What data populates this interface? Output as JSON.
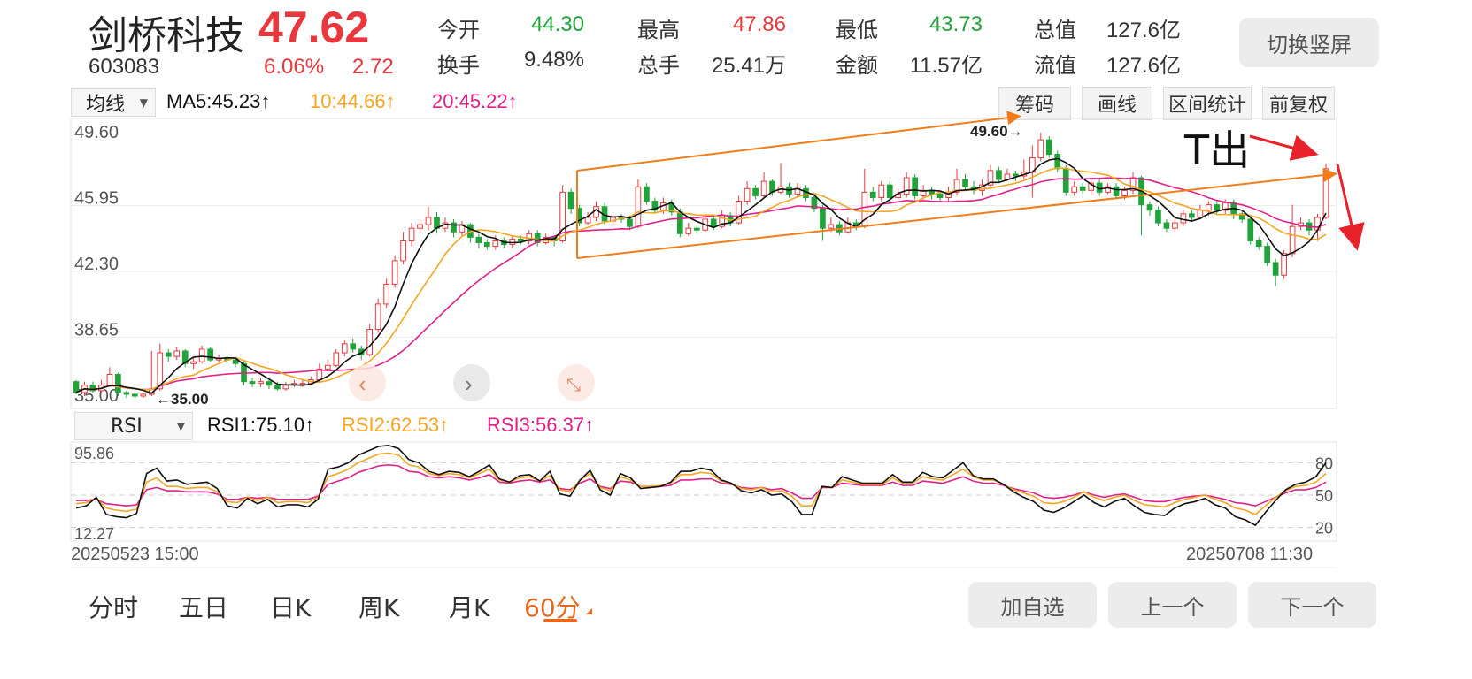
{
  "stock": {
    "name": "剑桥科技",
    "price": "47.62",
    "code": "603083",
    "pct": "6.06%",
    "change": "2.72"
  },
  "stats": [
    {
      "label": "今开",
      "value": "44.30",
      "color": "#21a33a"
    },
    {
      "label": "最高",
      "value": "47.86",
      "color": "#e8383d"
    },
    {
      "label": "最低",
      "value": "43.73",
      "color": "#21a33a"
    },
    {
      "label": "总值",
      "value": "127.6亿",
      "color": "#333333"
    },
    {
      "label": "换手",
      "value": "9.48%",
      "color": "#333333"
    },
    {
      "label": "总手",
      "value": "25.41万",
      "color": "#333333"
    },
    {
      "label": "金额",
      "value": "11.57亿",
      "color": "#333333"
    },
    {
      "label": "流值",
      "value": "127.6亿",
      "color": "#333333"
    }
  ],
  "switch_label": "切换竖屏",
  "ma": {
    "selector": "均线",
    "ma5": "MA5:45.23↑",
    "ma10": "10:44.66↑",
    "ma20": "20:45.22↑"
  },
  "tools": [
    "筹码",
    "画线",
    "区间统计",
    "前复权"
  ],
  "rsi": {
    "selector": "RSI",
    "rsi1": "RSI1:75.10↑",
    "rsi2": "RSI2:62.53↑",
    "rsi3": "RSI3:56.37↑"
  },
  "colors": {
    "up": "#e8383d",
    "down": "#21a33a",
    "ma5": "#111111",
    "ma10": "#f5a623",
    "ma20": "#e0218a",
    "channel": "#f07d1a",
    "accent": "#e8661e"
  },
  "chart_data": {
    "type": "candlestick",
    "price_axis_labels": [
      "49.60",
      "45.95",
      "42.30",
      "38.65",
      "35.00"
    ],
    "ylim": [
      35.0,
      49.6
    ],
    "annotations": {
      "high": "49.60→",
      "low": "←35.00",
      "handwritten": "T出"
    },
    "start_time": "20250523 15:00",
    "end_time": "20250708 11:30",
    "candles": [
      [
        35.8,
        35.2,
        35.9,
        35.1
      ],
      [
        35.2,
        35.6,
        35.8,
        35.0
      ],
      [
        35.6,
        35.3,
        35.8,
        35.2
      ],
      [
        35.3,
        35.6,
        35.9,
        35.2
      ],
      [
        35.6,
        36.2,
        36.6,
        35.5
      ],
      [
        36.2,
        35.2,
        36.3,
        35.0
      ],
      [
        35.2,
        35.1,
        35.3,
        34.9
      ],
      [
        35.1,
        35.0,
        35.2,
        34.9
      ],
      [
        35.0,
        35.1,
        35.2,
        34.9
      ],
      [
        35.1,
        35.4,
        37.5,
        35.0
      ],
      [
        35.4,
        37.4,
        37.9,
        35.3
      ],
      [
        37.4,
        37.2,
        37.6,
        36.9
      ],
      [
        37.2,
        37.5,
        37.7,
        37.0
      ],
      [
        37.5,
        36.8,
        37.6,
        36.6
      ],
      [
        36.8,
        36.9,
        37.1,
        36.5
      ],
      [
        36.9,
        37.6,
        37.8,
        36.8
      ],
      [
        37.6,
        37.0,
        37.7,
        36.9
      ],
      [
        37.0,
        37.1,
        37.3,
        36.9
      ],
      [
        37.1,
        37.0,
        37.3,
        36.8
      ],
      [
        37.0,
        36.8,
        37.1,
        36.6
      ],
      [
        36.8,
        35.8,
        37.0,
        35.6
      ],
      [
        35.8,
        35.7,
        36.0,
        35.5
      ],
      [
        35.7,
        35.8,
        36.0,
        35.5
      ],
      [
        35.8,
        35.6,
        36.0,
        35.4
      ],
      [
        35.6,
        35.4,
        35.8,
        35.3
      ],
      [
        35.4,
        35.6,
        35.8,
        35.3
      ],
      [
        35.6,
        35.7,
        35.9,
        35.5
      ],
      [
        35.7,
        35.7,
        35.9,
        35.5
      ],
      [
        35.7,
        35.9,
        36.1,
        35.6
      ],
      [
        35.9,
        36.5,
        36.8,
        35.8
      ],
      [
        36.5,
        36.7,
        37.0,
        36.4
      ],
      [
        36.7,
        37.4,
        37.6,
        36.6
      ],
      [
        37.4,
        37.9,
        38.1,
        37.2
      ],
      [
        37.9,
        37.6,
        38.2,
        37.4
      ],
      [
        37.6,
        37.3,
        37.8,
        37.0
      ],
      [
        37.3,
        38.7,
        39.0,
        37.2
      ],
      [
        38.7,
        40.1,
        40.4,
        38.5
      ],
      [
        40.1,
        41.2,
        41.5,
        39.9
      ],
      [
        41.2,
        42.5,
        42.8,
        41.0
      ],
      [
        42.5,
        43.6,
        44.1,
        42.3
      ],
      [
        43.6,
        44.3,
        44.6,
        43.3
      ],
      [
        44.3,
        44.5,
        44.8,
        44.0
      ],
      [
        44.5,
        44.9,
        45.5,
        44.2
      ],
      [
        44.9,
        44.3,
        45.2,
        44.0
      ],
      [
        44.3,
        44.6,
        44.9,
        44.1
      ],
      [
        44.6,
        44.1,
        44.8,
        43.8
      ],
      [
        44.1,
        44.5,
        44.7,
        43.9
      ],
      [
        44.5,
        43.8,
        44.6,
        43.5
      ],
      [
        43.8,
        43.5,
        44.0,
        43.2
      ],
      [
        43.5,
        43.3,
        43.7,
        43.1
      ],
      [
        43.3,
        43.6,
        43.9,
        43.1
      ],
      [
        43.6,
        43.4,
        43.8,
        43.2
      ],
      [
        43.4,
        43.7,
        43.9,
        43.2
      ],
      [
        43.7,
        43.6,
        43.9,
        43.4
      ],
      [
        43.6,
        44.0,
        44.2,
        43.4
      ],
      [
        44.0,
        43.5,
        44.2,
        43.3
      ],
      [
        43.5,
        43.8,
        44.0,
        43.4
      ],
      [
        43.8,
        43.6,
        43.9,
        43.3
      ],
      [
        43.6,
        46.3,
        46.7,
        43.5
      ],
      [
        46.3,
        45.4,
        46.5,
        45.1
      ],
      [
        45.4,
        44.6,
        45.6,
        44.4
      ],
      [
        44.6,
        44.9,
        45.2,
        44.5
      ],
      [
        44.9,
        45.5,
        45.8,
        44.7
      ],
      [
        45.5,
        44.7,
        45.7,
        44.5
      ],
      [
        44.7,
        44.9,
        45.1,
        44.5
      ],
      [
        44.9,
        44.8,
        45.1,
        44.6
      ],
      [
        44.8,
        44.4,
        45.0,
        44.2
      ],
      [
        44.4,
        46.6,
        47.0,
        44.3
      ],
      [
        46.6,
        45.8,
        46.8,
        45.6
      ],
      [
        45.8,
        45.3,
        46.0,
        45.1
      ],
      [
        45.3,
        45.7,
        46.0,
        45.1
      ],
      [
        45.7,
        45.2,
        45.9,
        45.0
      ],
      [
        45.2,
        44.0,
        45.4,
        43.8
      ],
      [
        44.0,
        44.3,
        44.6,
        43.9
      ],
      [
        44.3,
        44.2,
        44.5,
        44.0
      ],
      [
        44.2,
        44.8,
        45.0,
        44.1
      ],
      [
        44.8,
        44.4,
        45.0,
        44.2
      ],
      [
        44.4,
        45.0,
        45.3,
        44.3
      ],
      [
        45.0,
        44.6,
        45.2,
        44.4
      ],
      [
        44.6,
        45.8,
        46.1,
        44.5
      ],
      [
        45.8,
        46.5,
        46.9,
        45.6
      ],
      [
        46.5,
        46.1,
        46.7,
        45.9
      ],
      [
        46.1,
        46.9,
        47.4,
        46.0
      ],
      [
        46.9,
        46.3,
        47.0,
        46.1
      ],
      [
        46.3,
        46.6,
        47.9,
        46.2
      ],
      [
        46.6,
        46.2,
        46.8,
        46.0
      ],
      [
        46.2,
        46.5,
        46.8,
        46.0
      ],
      [
        46.5,
        46.0,
        46.7,
        45.8
      ],
      [
        46.0,
        45.4,
        46.2,
        45.2
      ],
      [
        45.4,
        44.3,
        45.6,
        43.6
      ],
      [
        44.3,
        44.5,
        44.9,
        44.1
      ],
      [
        44.5,
        44.1,
        44.7,
        43.9
      ],
      [
        44.1,
        44.6,
        44.9,
        44.0
      ],
      [
        44.6,
        44.4,
        44.8,
        44.2
      ],
      [
        44.4,
        46.3,
        47.6,
        44.3
      ],
      [
        46.3,
        46.0,
        46.6,
        45.8
      ],
      [
        46.0,
        46.7,
        46.9,
        45.8
      ],
      [
        46.7,
        46.0,
        46.9,
        45.8
      ],
      [
        46.0,
        46.2,
        46.5,
        45.9
      ],
      [
        46.2,
        47.1,
        47.4,
        46.0
      ],
      [
        47.1,
        46.1,
        47.3,
        45.9
      ],
      [
        46.1,
        46.4,
        46.7,
        45.9
      ],
      [
        46.4,
        46.2,
        46.6,
        45.9
      ],
      [
        46.2,
        46.0,
        46.4,
        45.8
      ],
      [
        46.0,
        46.3,
        46.6,
        45.8
      ],
      [
        46.3,
        47.0,
        47.6,
        46.1
      ],
      [
        47.0,
        46.6,
        47.3,
        46.4
      ],
      [
        46.6,
        46.4,
        46.9,
        46.2
      ],
      [
        46.4,
        46.7,
        47.0,
        46.1
      ],
      [
        46.7,
        47.5,
        47.8,
        46.5
      ],
      [
        47.5,
        47.0,
        47.7,
        46.8
      ],
      [
        47.0,
        47.3,
        47.6,
        46.9
      ],
      [
        47.3,
        47.2,
        47.5,
        46.9
      ],
      [
        47.2,
        47.4,
        48.1,
        47.0
      ],
      [
        47.4,
        48.2,
        48.9,
        46.0
      ],
      [
        48.2,
        49.2,
        49.6,
        48.0
      ],
      [
        49.2,
        48.4,
        49.4,
        48.2
      ],
      [
        48.4,
        47.6,
        48.6,
        47.4
      ],
      [
        47.6,
        46.3,
        47.8,
        46.1
      ],
      [
        46.3,
        46.6,
        46.9,
        46.1
      ],
      [
        46.6,
        46.4,
        46.8,
        46.2
      ],
      [
        46.4,
        46.8,
        47.0,
        46.1
      ],
      [
        46.8,
        46.3,
        47.0,
        46.1
      ],
      [
        46.3,
        46.6,
        46.8,
        46.2
      ],
      [
        46.6,
        46.1,
        46.8,
        45.9
      ],
      [
        46.1,
        46.4,
        46.6,
        45.9
      ],
      [
        46.4,
        47.1,
        47.4,
        46.2
      ],
      [
        47.1,
        45.6,
        47.2,
        43.9
      ],
      [
        45.6,
        45.3,
        45.8,
        45.0
      ],
      [
        45.3,
        44.6,
        45.5,
        44.4
      ],
      [
        44.6,
        44.3,
        44.8,
        44.1
      ],
      [
        44.3,
        44.6,
        44.8,
        44.1
      ],
      [
        44.6,
        45.1,
        45.3,
        44.4
      ],
      [
        45.1,
        44.9,
        45.3,
        44.7
      ],
      [
        44.9,
        45.3,
        45.6,
        44.8
      ],
      [
        45.3,
        45.6,
        45.8,
        45.0
      ],
      [
        45.6,
        45.3,
        45.8,
        45.1
      ],
      [
        45.3,
        45.7,
        45.9,
        45.1
      ],
      [
        45.7,
        45.1,
        45.9,
        44.8
      ],
      [
        45.1,
        44.8,
        45.3,
        44.6
      ],
      [
        44.8,
        43.6,
        45.0,
        43.4
      ],
      [
        43.6,
        43.3,
        43.8,
        43.1
      ],
      [
        43.3,
        42.4,
        43.5,
        42.2
      ],
      [
        42.4,
        41.7,
        42.6,
        41.1
      ],
      [
        41.7,
        42.9,
        43.1,
        41.5
      ],
      [
        42.9,
        44.4,
        45.6,
        42.7
      ],
      [
        44.4,
        44.6,
        44.9,
        44.2
      ],
      [
        44.6,
        44.2,
        44.8,
        43.9
      ],
      [
        44.2,
        44.9,
        45.1,
        43.6
      ],
      [
        44.9,
        47.6,
        47.9,
        44.8
      ]
    ],
    "rsi_axis_labels": {
      "left_top": "95.86",
      "left_bottom": "12.27",
      "right": [
        "80",
        "50",
        "20"
      ]
    },
    "rsi_ylim": [
      12.27,
      95.86
    ],
    "rsi1": [
      38,
      40,
      48,
      32,
      30,
      29,
      33,
      70,
      75,
      63,
      64,
      60,
      61,
      62,
      56,
      40,
      38,
      47,
      42,
      46,
      39,
      41,
      41,
      39,
      46,
      74,
      76,
      80,
      87,
      91,
      95,
      96,
      93,
      83,
      80,
      72,
      69,
      72,
      71,
      67,
      72,
      78,
      65,
      62,
      68,
      69,
      63,
      72,
      51,
      49,
      64,
      73,
      55,
      50,
      70,
      66,
      56,
      57,
      58,
      62,
      72,
      72,
      75,
      73,
      64,
      61,
      54,
      52,
      55,
      50,
      51,
      44,
      32,
      32,
      58,
      57,
      67,
      64,
      61,
      61,
      61,
      69,
      62,
      62,
      71,
      67,
      66,
      73,
      80,
      68,
      65,
      65,
      60,
      53,
      48,
      44,
      36,
      34,
      38,
      44,
      50,
      43,
      39,
      44,
      47,
      40,
      34,
      32,
      31,
      38,
      42,
      44,
      47,
      41,
      38,
      30,
      27,
      22,
      34,
      45,
      55,
      60,
      62,
      67,
      80
    ],
    "rsi2": [
      42,
      43,
      47,
      38,
      36,
      35,
      37,
      62,
      66,
      58,
      58,
      56,
      57,
      57,
      53,
      44,
      43,
      48,
      45,
      48,
      43,
      44,
      44,
      43,
      48,
      67,
      70,
      74,
      80,
      84,
      88,
      89,
      87,
      78,
      76,
      70,
      68,
      70,
      69,
      66,
      70,
      74,
      64,
      62,
      66,
      67,
      63,
      68,
      55,
      53,
      64,
      70,
      57,
      54,
      67,
      64,
      58,
      58,
      59,
      61,
      69,
      69,
      71,
      70,
      63,
      61,
      56,
      55,
      57,
      53,
      54,
      49,
      40,
      40,
      58,
      57,
      64,
      62,
      60,
      60,
      60,
      66,
      61,
      61,
      67,
      65,
      64,
      69,
      74,
      67,
      64,
      64,
      60,
      55,
      52,
      49,
      43,
      42,
      44,
      48,
      53,
      48,
      45,
      48,
      50,
      45,
      41,
      40,
      39,
      43,
      46,
      48,
      50,
      46,
      43,
      38,
      36,
      32,
      40,
      48,
      54,
      58,
      59,
      62,
      70
    ],
    "rsi3": [
      45,
      45,
      46,
      42,
      41,
      40,
      41,
      55,
      57,
      54,
      54,
      53,
      53,
      53,
      51,
      46,
      46,
      48,
      47,
      48,
      46,
      46,
      46,
      46,
      49,
      60,
      63,
      66,
      71,
      74,
      77,
      78,
      77,
      72,
      71,
      67,
      66,
      67,
      66,
      64,
      66,
      69,
      62,
      61,
      63,
      64,
      62,
      64,
      56,
      55,
      61,
      65,
      58,
      56,
      63,
      62,
      58,
      58,
      58,
      59,
      64,
      64,
      65,
      65,
      61,
      60,
      57,
      56,
      57,
      55,
      56,
      52,
      47,
      47,
      57,
      57,
      61,
      60,
      59,
      59,
      59,
      62,
      59,
      59,
      63,
      62,
      61,
      64,
      67,
      63,
      61,
      61,
      59,
      56,
      54,
      52,
      48,
      47,
      48,
      50,
      53,
      50,
      48,
      50,
      51,
      48,
      45,
      44,
      44,
      46,
      48,
      49,
      50,
      48,
      46,
      43,
      42,
      40,
      44,
      48,
      52,
      55,
      55,
      57,
      62
    ]
  },
  "times": {
    "start": "20250523 15:00",
    "end": "20250708 11:30"
  },
  "tabs": [
    "分时",
    "五日",
    "日K",
    "周K",
    "月K",
    "60分"
  ],
  "actions": [
    "加自选",
    "上一个",
    "下一个"
  ]
}
